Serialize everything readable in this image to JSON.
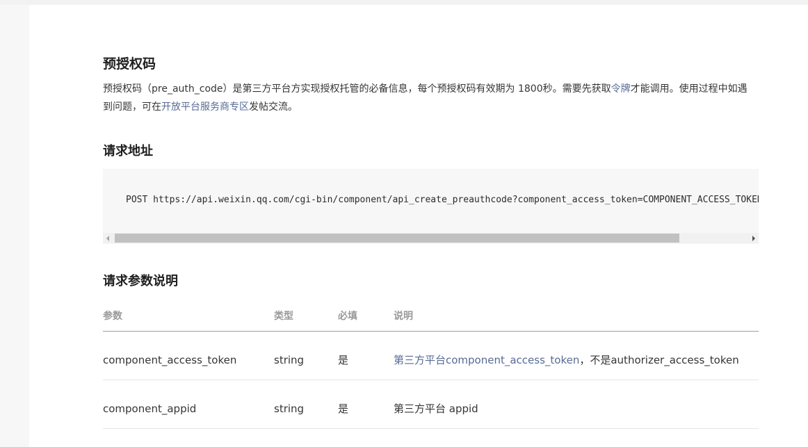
{
  "page": {
    "heading": "预授权码",
    "description": {
      "part1": "预授权码（pre_auth_code）是第三方平台方实现授权托管的必备信息，每个预授权码有效期为 1800秒。需要先获取",
      "link1": "令牌",
      "part2": "才能调用。使用过程中如遇到问题，可在",
      "link2": "开放平台服务商专区",
      "part3": "发帖交流。"
    }
  },
  "request_url": {
    "heading": "请求地址",
    "code": "POST https://api.weixin.qq.com/cgi-bin/component/api_create_preauthcode?component_access_token=COMPONENT_ACCESS_TOKEN"
  },
  "params": {
    "heading": "请求参数说明",
    "columns": [
      "参数",
      "类型",
      "必填",
      "说明"
    ],
    "rows": [
      {
        "name": "component_access_token",
        "type": "string",
        "required": "是",
        "desc_link": "第三方平台component_access_token",
        "desc_text": "，不是authorizer_access_token"
      },
      {
        "name": "component_appid",
        "type": "string",
        "required": "是",
        "desc_link": "",
        "desc_text": "第三方平台 appid"
      }
    ]
  }
}
